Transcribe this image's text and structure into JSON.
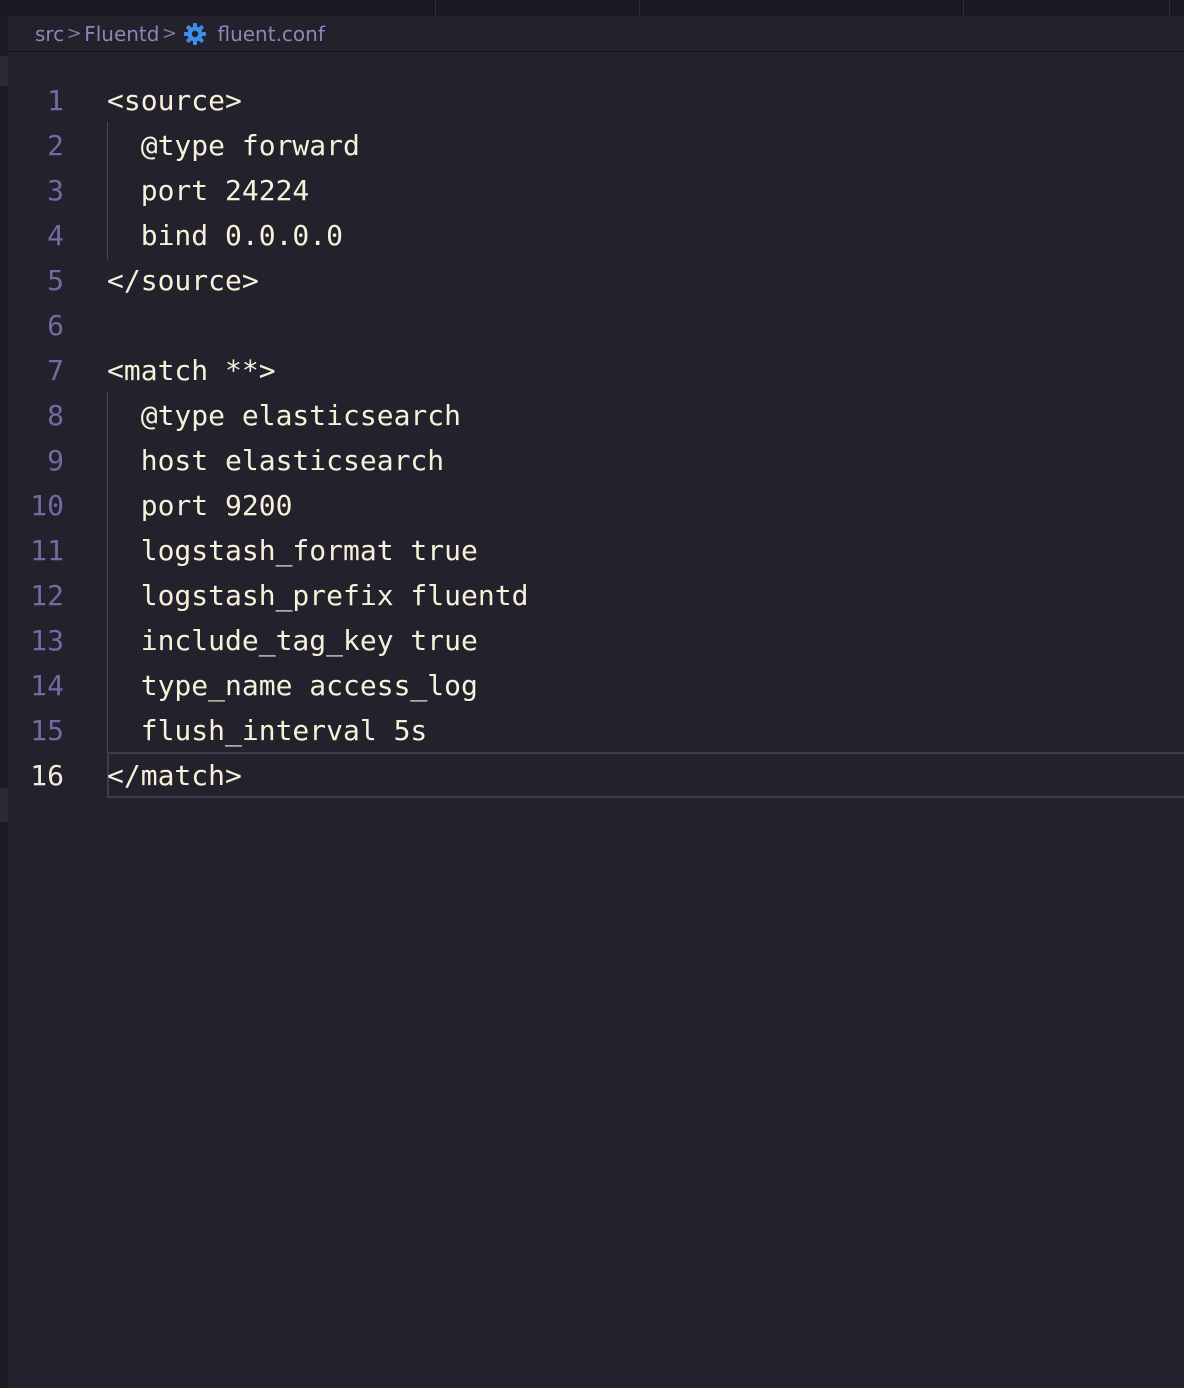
{
  "breadcrumb": {
    "items": [
      "src",
      "Fluentd",
      "fluent.conf"
    ],
    "separator": ">"
  },
  "icons": {
    "file_icon": "gear-icon",
    "file_icon_color": "#3d8ee8"
  },
  "editor": {
    "active_line": 16,
    "lines": [
      {
        "num": "1",
        "text": "<source>"
      },
      {
        "num": "2",
        "text": "  @type forward"
      },
      {
        "num": "3",
        "text": "  port 24224"
      },
      {
        "num": "4",
        "text": "  bind 0.0.0.0"
      },
      {
        "num": "5",
        "text": "</source>"
      },
      {
        "num": "6",
        "text": ""
      },
      {
        "num": "7",
        "text": "<match **>"
      },
      {
        "num": "8",
        "text": "  @type elasticsearch"
      },
      {
        "num": "9",
        "text": "  host elasticsearch"
      },
      {
        "num": "10",
        "text": "  port 9200"
      },
      {
        "num": "11",
        "text": "  logstash_format true"
      },
      {
        "num": "12",
        "text": "  logstash_prefix fluentd"
      },
      {
        "num": "13",
        "text": "  include_tag_key true"
      },
      {
        "num": "14",
        "text": "  type_name access_log"
      },
      {
        "num": "15",
        "text": "  flush_interval 5s"
      },
      {
        "num": "16",
        "text": "</match>"
      }
    ]
  },
  "colors": {
    "background": "#22212c",
    "text": "#f6f1d9",
    "line_number": "#6f6ba3",
    "breadcrumb_text": "#8a88b4"
  }
}
